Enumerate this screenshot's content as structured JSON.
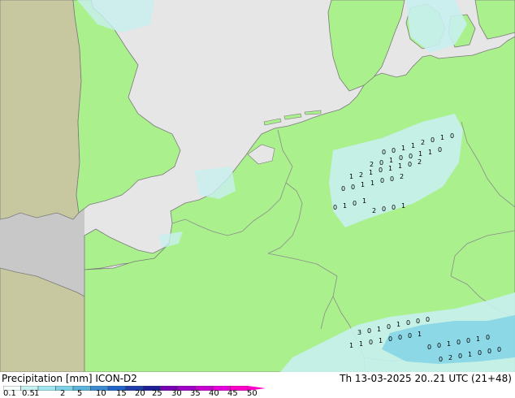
{
  "map": {
    "colors": {
      "sea": "#e6e6e6",
      "model_domain_land": "#aaf08c",
      "outside_land": "#c8c8a0",
      "outside_sea": "#c8c8c8",
      "borders": "#8c8c8c",
      "coast": "#7a7a7a",
      "precip_light": "#c8f0f0",
      "precip_medium": "#7dd2e6"
    },
    "grid_value_labels": [
      "0",
      "0",
      "1",
      "1",
      "2",
      "0",
      "1",
      "0",
      "2",
      "0",
      "1",
      "0",
      "0",
      "1",
      "1",
      "0",
      "1",
      "2",
      "1",
      "0",
      "1",
      "1",
      "0",
      "2",
      "0",
      "0",
      "1",
      "1",
      "0",
      "0",
      "2",
      "0",
      "1",
      "0",
      "1",
      "2",
      "0",
      "0",
      "1",
      "3",
      "0",
      "1",
      "0",
      "1",
      "0",
      "0",
      "0",
      "1",
      "1",
      "0",
      "1",
      "0",
      "0",
      "0",
      "1",
      "0",
      "0",
      "1",
      "0",
      "0",
      "1",
      "0",
      "0",
      "2",
      "0",
      "1",
      "0",
      "0",
      "0",
      "1"
    ]
  },
  "footer": {
    "product": "Precipitation [mm]  ICON-D2",
    "valid_time": "Th 13-03-2025 20..21 UTC (21+48)"
  },
  "legend": {
    "labels": [
      "0.1",
      "0.5",
      "1",
      "2",
      "5",
      "10",
      "15",
      "20",
      "25",
      "30",
      "35",
      "40",
      "45",
      "50"
    ],
    "colors": [
      "#f5fafa",
      "#c8f0f0",
      "#a0e6f0",
      "#7dd2e6",
      "#5ab4dc",
      "#3c8cd2",
      "#2064c8",
      "#1e3caa",
      "#1e1e96",
      "#7800b4",
      "#a000c8",
      "#c800d2",
      "#e600dc",
      "#ff00c8"
    ]
  }
}
